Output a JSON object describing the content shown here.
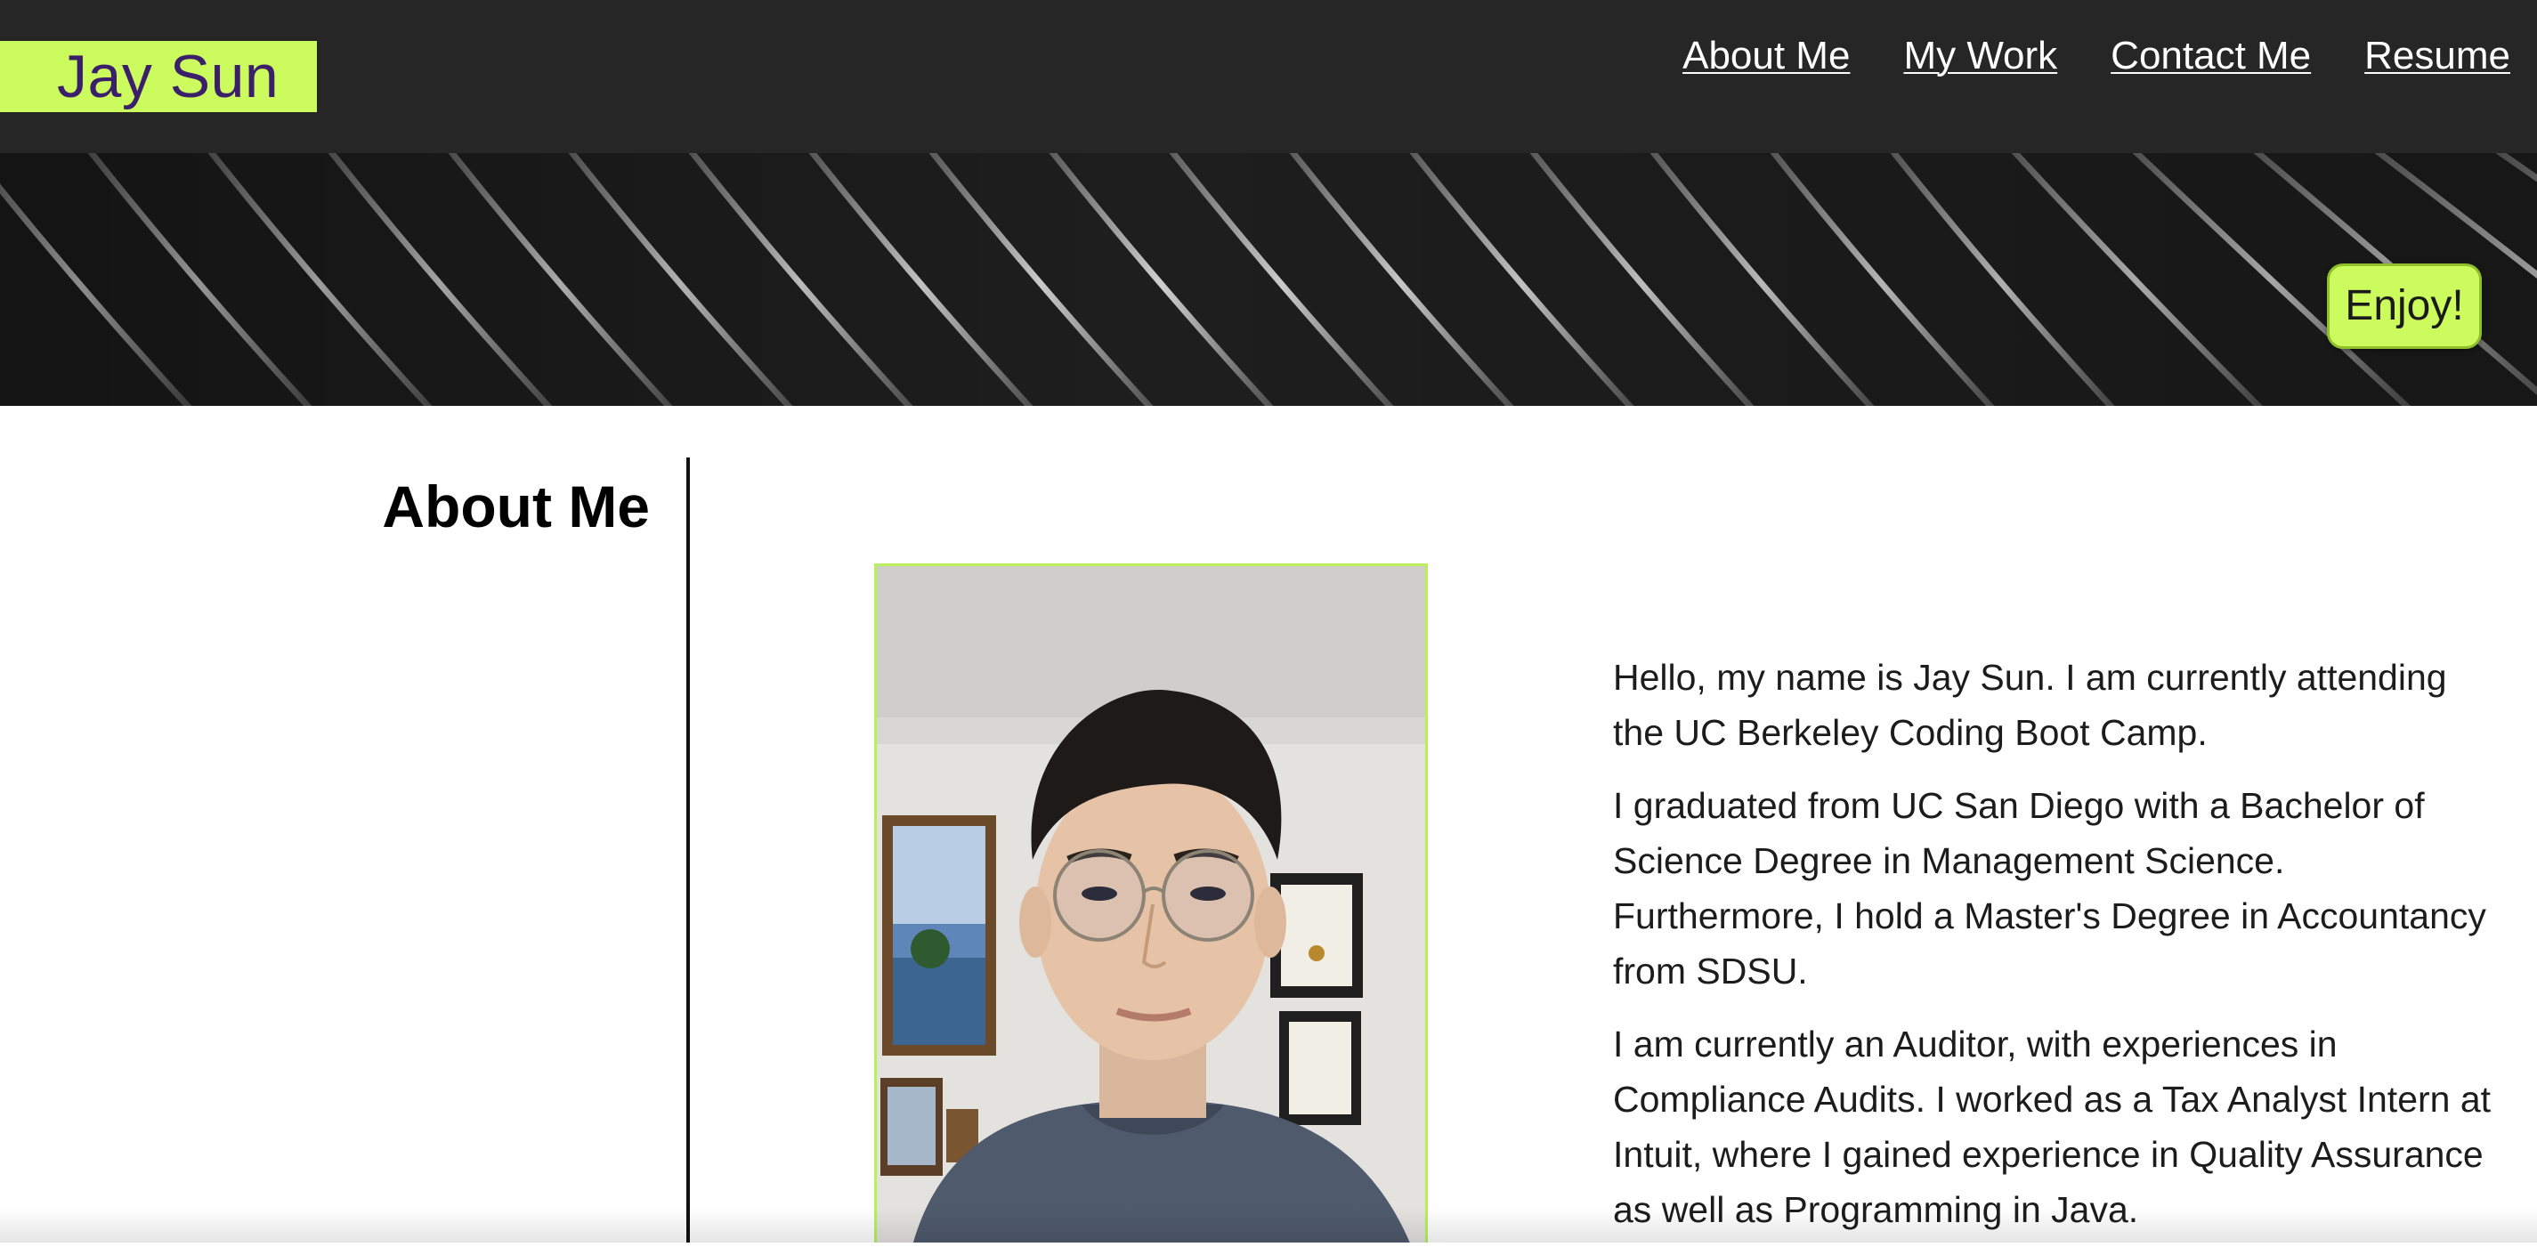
{
  "header": {
    "brand": "Jay Sun",
    "nav": [
      "About Me",
      "My Work",
      "Contact Me",
      "Resume"
    ]
  },
  "hero": {
    "button_label": "Enjoy!"
  },
  "about": {
    "heading": "About Me",
    "paragraphs": [
      "Hello, my name is Jay Sun. I am currently attending the UC Berkeley Coding Boot Camp.",
      "I graduated from UC San Diego with a Bachelor of Science Degree in Management Science. Furthermore, I hold a Master's Degree in Accountancy from SDSU.",
      "I am currently an Auditor, with experiences in Compliance Audits. I worked as a Tax Analyst Intern at Intuit, where I gained experience in Quality Assurance as well as Programming in Java."
    ]
  },
  "colors": {
    "accent": "#cbfb5c",
    "brand_text": "#3b1f6b",
    "header_bg": "#262626",
    "photo_border": "#b9ef5a"
  },
  "icons": {
    "hero_background": "diagonal-stripes-pattern",
    "profile_photo": "portrait-photo"
  }
}
